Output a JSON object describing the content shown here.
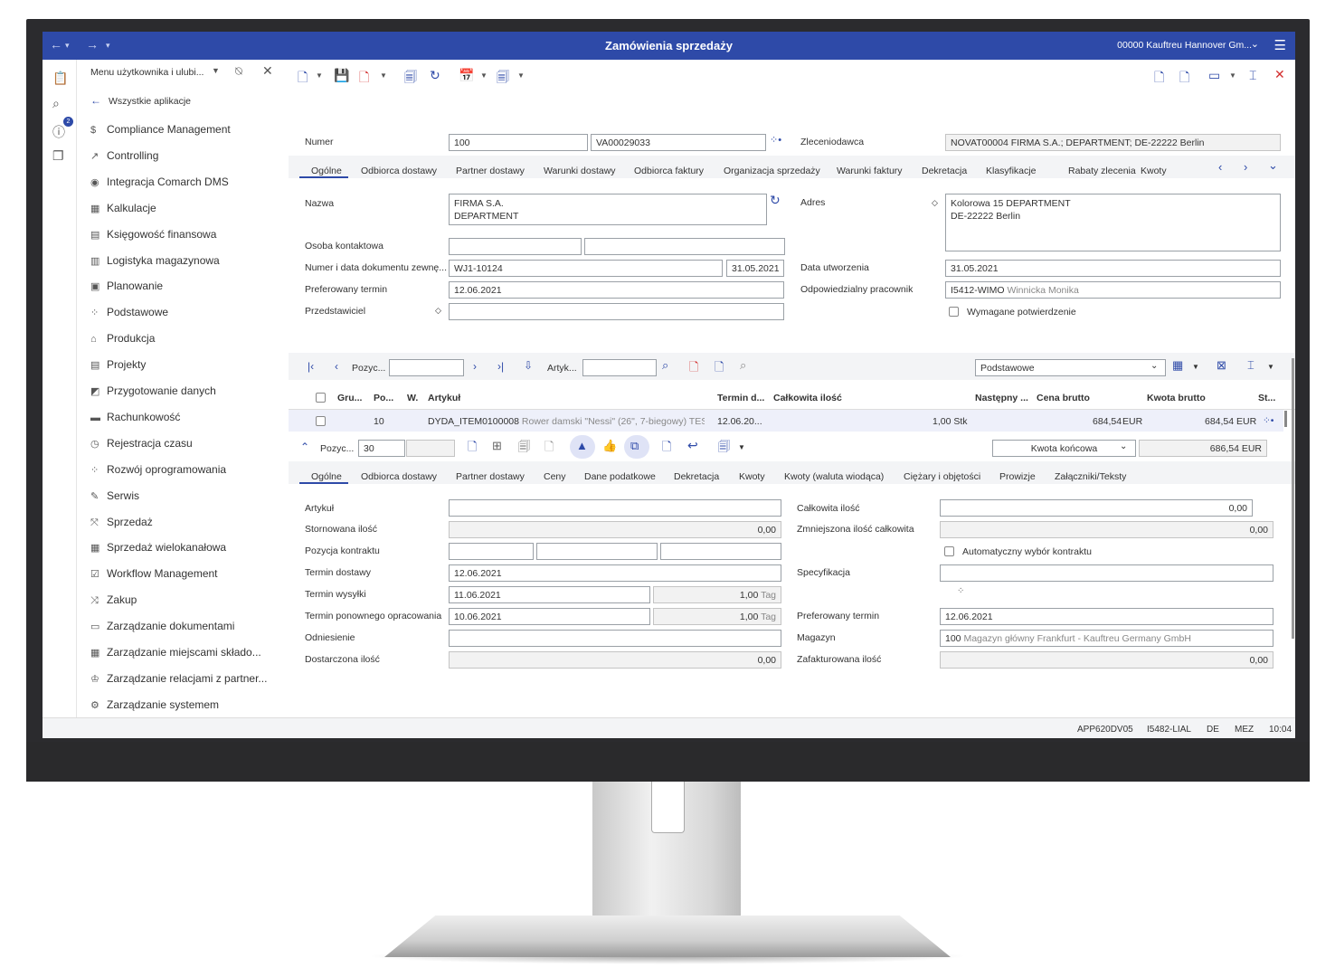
{
  "window": {
    "title": "Zamówienia sprzedaży",
    "company": "00000 Kauftreu Hannover Gm..."
  },
  "sidebar": {
    "header": "Menu użytkownika i ulubi...",
    "back": "Wszystkie aplikacje",
    "items": [
      {
        "label": "Compliance Management",
        "icon": "dollar-icon"
      },
      {
        "label": "Controlling",
        "icon": "trend-icon"
      },
      {
        "label": "Integracja Comarch DMS",
        "icon": "dms-icon"
      },
      {
        "label": "Kalkulacje",
        "icon": "calculator-icon"
      },
      {
        "label": "Księgowość finansowa",
        "icon": "finance-icon"
      },
      {
        "label": "Logistyka magazynowa",
        "icon": "warehouse-icon"
      },
      {
        "label": "Planowanie",
        "icon": "calendar-icon"
      },
      {
        "label": "Podstawowe",
        "icon": "basic-icon"
      },
      {
        "label": "Produkcja",
        "icon": "factory-icon"
      },
      {
        "label": "Projekty",
        "icon": "project-icon"
      },
      {
        "label": "Przygotowanie danych",
        "icon": "data-icon"
      },
      {
        "label": "Rachunkowość",
        "icon": "accounting-icon"
      },
      {
        "label": "Rejestracja czasu",
        "icon": "time-icon"
      },
      {
        "label": "Rozwój oprogramowania",
        "icon": "dev-icon"
      },
      {
        "label": "Serwis",
        "icon": "service-icon"
      },
      {
        "label": "Sprzedaż",
        "icon": "sales-icon"
      },
      {
        "label": "Sprzedaż wielokanałowa",
        "icon": "omni-icon"
      },
      {
        "label": "Workflow Management",
        "icon": "workflow-icon"
      },
      {
        "label": "Zakup",
        "icon": "purchase-icon"
      },
      {
        "label": "Zarządzanie dokumentami",
        "icon": "folder-icon"
      },
      {
        "label": "Zarządzanie miejscami składo...",
        "icon": "storage-icon"
      },
      {
        "label": "Zarządzanie relacjami z partner...",
        "icon": "crown-icon"
      },
      {
        "label": "Zarządzanie systemem",
        "icon": "gear-icon"
      }
    ]
  },
  "header": {
    "numer_label": "Numer",
    "numer": "100",
    "numer2": "VA00029033",
    "zleceniodawca_label": "Zleceniodawca",
    "zleceniodawca": "NOVAT00004 FIRMA S.A.; DEPARTMENT; DE-22222 Berlin",
    "tabs": [
      "Ogólne",
      "Odbiorca dostawy",
      "Partner dostawy",
      "Warunki dostawy",
      "Odbiorca faktury",
      "Organizacja sprzedaży",
      "Warunki faktury",
      "Dekretacja",
      "Klasyfikacje",
      "Rabaty zlecenia",
      "Kwoty"
    ],
    "nazwa_label": "Nazwa",
    "nazwa1": "FIRMA S.A.",
    "nazwa2": "DEPARTMENT",
    "adres_label": "Adres",
    "adres1": "Kolorowa 15 DEPARTMENT",
    "adres2": "DE-22222 Berlin",
    "osoba_label": "Osoba kontaktowa",
    "numer_dok_label": "Numer i data dokumentu zewnę...",
    "numer_dok": "WJ1-10124",
    "numer_dok_data": "31.05.2021",
    "data_utw_label": "Data utworzenia",
    "data_utw": "31.05.2021",
    "pref_label": "Preferowany termin",
    "pref": "12.06.2021",
    "odp_label": "Odpowiedzialny pracownik",
    "odp_code": "I5412-WIMO",
    "odp_name": "Winnicka Monika",
    "przedst_label": "Przedstawiciel",
    "wymagane_label": "Wymagane potwierdzenie"
  },
  "grid": {
    "pozycja_label": "Pozyc...",
    "artykul_label": "Artyk...",
    "view": "Podstawowe",
    "columns": [
      "Gru...",
      "Po...",
      "W.",
      "Artykuł",
      "Termin d...",
      "Całkowita ilość",
      "Następny ...",
      "Cena brutto",
      "Kwota brutto",
      "St..."
    ],
    "row": {
      "pos": "10",
      "art_code": "DYDA_ITEM0100008",
      "art_name": "Rower damski \"Nessi\" (26\", 7-biegowy) TEST ...",
      "termin": "12.06.20...",
      "ilosc": "1,00 Stk",
      "cena": "684,54",
      "cena_cur": "EUR",
      "kwota": "684,54 EUR"
    }
  },
  "detail": {
    "pozycja_label": "Pozyc...",
    "pozycja": "30",
    "kwota_label": "Kwota końcowa",
    "kwota": "686,54 EUR",
    "tabs": [
      "Ogólne",
      "Odbiorca dostawy",
      "Partner dostawy",
      "Ceny",
      "Dane podatkowe",
      "Dekretacja",
      "Kwoty",
      "Kwoty (waluta wiodąca)",
      "Ciężary i objętości",
      "Prowizje",
      "Załączniki/Teksty"
    ],
    "artykul_label": "Artykuł",
    "calk_label": "Całkowita ilość",
    "calk": "0,00",
    "storn_label": "Stornowana ilość",
    "storn": "0,00",
    "zmn_label": "Zmniejszona ilość całkowita",
    "zmn": "0,00",
    "poz_kontr_label": "Pozycja kontraktu",
    "auto_label": "Automatyczny wybór kontraktu",
    "termin_dost_label": "Termin dostawy",
    "termin_dost": "12.06.2021",
    "spec_label": "Specyfikacja",
    "termin_wys_label": "Termin wysyłki",
    "termin_wys": "11.06.2021",
    "termin_wys_days": "1,00",
    "tag": "Tag",
    "termin_pon_label": "Termin ponownego opracowania",
    "termin_pon": "10.06.2021",
    "termin_pon_days": "1,00",
    "pref_label": "Preferowany termin",
    "pref": "12.06.2021",
    "odn_label": "Odniesienie",
    "magazyn_label": "Magazyn",
    "magazyn_code": "100",
    "magazyn_name": "Magazyn główny Frankfurt - Kauftreu Germany GmbH",
    "dost_label": "Dostarczona ilość",
    "dost": "0,00",
    "zaf_label": "Zafakturowana ilość",
    "zaf": "0,00"
  },
  "status": {
    "app": "APP620DV05",
    "user": "I5482-LIAL",
    "lang": "DE",
    "tz": "MEZ",
    "time": "10:04"
  },
  "colors": {
    "accent": "#2e4aa8",
    "close": "#d32f2f"
  }
}
